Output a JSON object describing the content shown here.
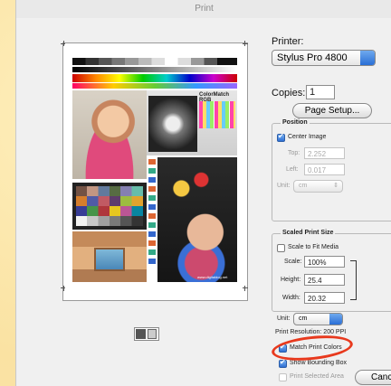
{
  "window": {
    "title": "Print"
  },
  "printer": {
    "label": "Printer:",
    "value": "Stylus Pro 4800"
  },
  "copies": {
    "label": "Copies:",
    "value": "1"
  },
  "page_setup": {
    "label": "Page Setup..."
  },
  "position": {
    "title": "Position",
    "center_image": "Center Image",
    "top_label": "Top:",
    "top_value": "2.252",
    "left_label": "Left:",
    "left_value": "0.017",
    "unit_label": "Unit:",
    "unit_value": "cm"
  },
  "scaled": {
    "title": "Scaled Print Size",
    "scale_to_fit": "Scale to Fit Media",
    "scale_label": "Scale:",
    "scale_value": "100%",
    "height_label": "Height:",
    "height_value": "25.4",
    "width_label": "Width:",
    "width_value": "20.32",
    "unit_label": "Unit:",
    "unit_value": "cm",
    "resolution": "Print Resolution: 200 PPI"
  },
  "options": {
    "match_print_colors": "Match Print Colors",
    "show_bounding_box": "Show Bounding Box",
    "print_selected_area": "Print Selected Area"
  },
  "buttons": {
    "cancel": "Canc"
  },
  "preview": {
    "colormatch": "ColorMatch RGB",
    "side_text": "The Digital Dog",
    "credit": "www.digitaldog.net"
  },
  "colors": {
    "highlight_ring": "#e8391d",
    "accent": "#2e6fd3"
  }
}
